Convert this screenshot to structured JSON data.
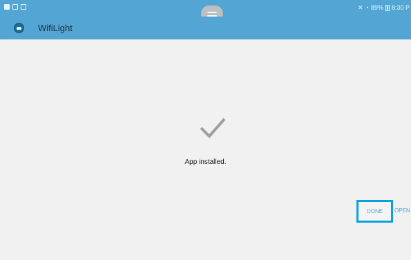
{
  "status_bar": {
    "notification_icons": [
      "screenshot-icon",
      "tablet-icon",
      "gallery-icon"
    ],
    "icons": [
      "mute-icon",
      "wifi-icon"
    ],
    "battery": "89%",
    "time": "8:30 P"
  },
  "app_bar": {
    "title": "WifiLight",
    "icon": "android-icon"
  },
  "main": {
    "status_icon": "checkmark-icon",
    "status_text": "App installed."
  },
  "actions": {
    "done_label": "DONE",
    "open_label": "OPEN"
  },
  "colors": {
    "app_bar": "#53a6d4",
    "background": "#f1f1f1",
    "action_text": "#5aa7cc",
    "highlight": "#0aa2dd"
  }
}
